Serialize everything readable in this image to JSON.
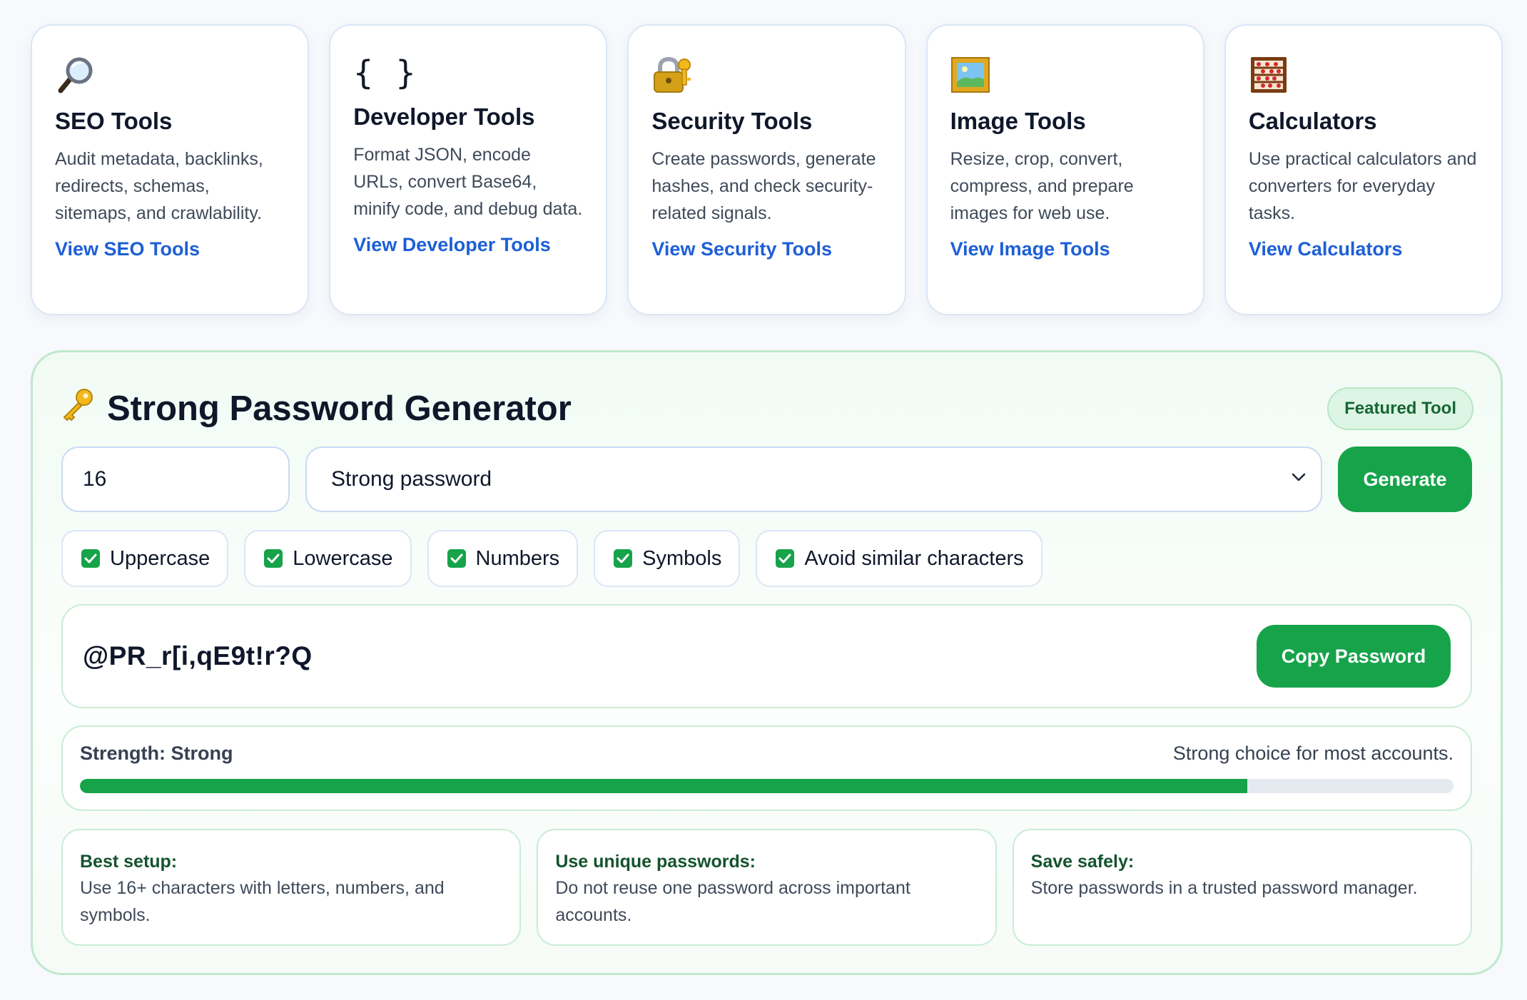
{
  "categories": [
    {
      "icon": "magnifier-icon",
      "title": "SEO Tools",
      "description": "Audit metadata, backlinks, redirects, schemas, sitemaps, and crawlability.",
      "link": "View SEO Tools"
    },
    {
      "icon": "braces-icon",
      "icon_text": "{ }",
      "title": "Developer Tools",
      "description": "Format JSON, encode URLs, convert Base64, minify code, and debug data.",
      "link": "View Developer Tools"
    },
    {
      "icon": "lock-key-icon",
      "title": "Security Tools",
      "description": "Create passwords, generate hashes, and check security-related signals.",
      "link": "View Security Tools"
    },
    {
      "icon": "framed-picture-icon",
      "title": "Image Tools",
      "description": "Resize, crop, convert, compress, and prepare images for web use.",
      "link": "View Image Tools"
    },
    {
      "icon": "abacus-icon",
      "title": "Calculators",
      "description": "Use practical calculators and converters for everyday tasks.",
      "link": "View Calculators"
    }
  ],
  "tool": {
    "icon": "key-icon",
    "title": "Strong Password Generator",
    "badge": "Featured Tool",
    "length_value": "16",
    "preset_selected": "Strong password",
    "generate_label": "Generate",
    "options": [
      {
        "label": "Uppercase",
        "checked": true
      },
      {
        "label": "Lowercase",
        "checked": true
      },
      {
        "label": "Numbers",
        "checked": true
      },
      {
        "label": "Symbols",
        "checked": true
      },
      {
        "label": "Avoid similar characters",
        "checked": true
      }
    ],
    "password": "@PR_r[i,qE9t!r?Q",
    "copy_label": "Copy Password",
    "strength_label": "Strength: Strong",
    "strength_note": "Strong choice for most accounts.",
    "strength_fraction": 0.85,
    "tips": [
      {
        "title": "Best setup:",
        "text": "Use 16+ characters with letters, numbers, and symbols."
      },
      {
        "title": "Use unique passwords:",
        "text": "Do not reuse one password across important accounts."
      },
      {
        "title": "Save safely:",
        "text": "Store passwords in a trusted password manager."
      }
    ]
  },
  "colors": {
    "accent_green": "#16a34a",
    "link_blue": "#1d5fd6",
    "tip_title_green": "#14532d"
  }
}
